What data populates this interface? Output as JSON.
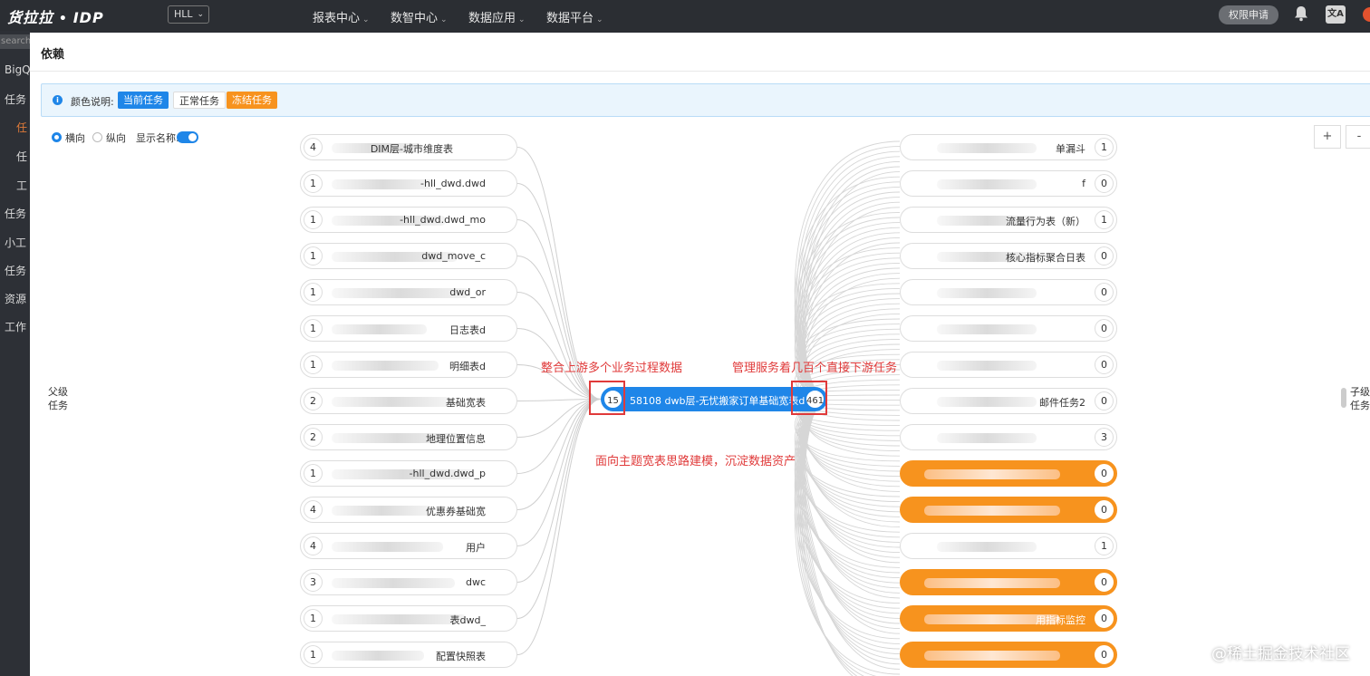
{
  "topbar": {
    "logo": "货拉拉",
    "logo_suffix": "IDP",
    "env_select": "HLL",
    "menus": [
      "报表中心",
      "数智中心",
      "数据应用",
      "数据平台"
    ],
    "permission_button": "权限申请",
    "lang_icon": "文A"
  },
  "sidebar": {
    "search_placeholder": "search...",
    "items": [
      "BigQ",
      "任务",
      "任",
      "任",
      "工",
      "任务",
      "小工",
      "任务",
      "资源",
      "工作"
    ]
  },
  "modal": {
    "title": "依赖",
    "legend": {
      "label": "颜色说明:",
      "current": "当前任务",
      "normal": "正常任务",
      "frozen": "冻结任务"
    },
    "controls": {
      "horizontal": "横向",
      "vertical": "纵向",
      "show_name": "显示名称:"
    },
    "zoom": {
      "in": "+",
      "out": "-"
    },
    "parent_label": "父级任务",
    "child_label": "子级任务"
  },
  "graph": {
    "center": {
      "upstream_count": "15",
      "label": "58108 dwb层-无忧搬家订单基础宽表dw",
      "downstream_count": "461"
    },
    "upstream": [
      {
        "count": "4",
        "label": "DIM层-城市维度表"
      },
      {
        "count": "1",
        "label": "-hll_dwd.dwd"
      },
      {
        "count": "1",
        "label": "-hll_dwd.dwd_mo"
      },
      {
        "count": "1",
        "label": "dwd_move_c"
      },
      {
        "count": "1",
        "label": "dwd_or"
      },
      {
        "count": "1",
        "label": "日志表d"
      },
      {
        "count": "1",
        "label": "明细表d"
      },
      {
        "count": "2",
        "label": "基础宽表"
      },
      {
        "count": "2",
        "label": "地理位置信息"
      },
      {
        "count": "1",
        "label": "-hll_dwd.dwd_p"
      },
      {
        "count": "4",
        "label": "优惠券基础宽"
      },
      {
        "count": "4",
        "label": "用户"
      },
      {
        "count": "3",
        "label": "dwc"
      },
      {
        "count": "1",
        "label": "表dwd_"
      },
      {
        "count": "1",
        "label": "配置快照表"
      }
    ],
    "downstream": [
      {
        "count": "1",
        "label": "单漏斗",
        "frozen": false
      },
      {
        "count": "0",
        "label": "f",
        "frozen": false
      },
      {
        "count": "1",
        "label": "流量行为表（新）",
        "frozen": false
      },
      {
        "count": "0",
        "label": "核心指标聚合日表",
        "frozen": false
      },
      {
        "count": "0",
        "label": "",
        "frozen": false
      },
      {
        "count": "0",
        "label": "",
        "frozen": false
      },
      {
        "count": "0",
        "label": "",
        "frozen": false
      },
      {
        "count": "0",
        "label": "邮件任务2",
        "frozen": false
      },
      {
        "count": "3",
        "label": "",
        "frozen": false
      },
      {
        "count": "0",
        "label": "",
        "frozen": true
      },
      {
        "count": "0",
        "label": "",
        "frozen": true
      },
      {
        "count": "1",
        "label": "",
        "frozen": false
      },
      {
        "count": "0",
        "label": "",
        "frozen": true
      },
      {
        "count": "0",
        "label": "用指标监控",
        "frozen": true
      },
      {
        "count": "0",
        "label": "",
        "frozen": true
      }
    ]
  },
  "annotations": {
    "upstream": "整合上游多个业务过程数据",
    "downstream": "管理服务着几百个直接下游任务",
    "bottom": "面向主题宽表思路建模，沉淀数据资产"
  },
  "watermark": "@稀土掘金技术社区"
}
